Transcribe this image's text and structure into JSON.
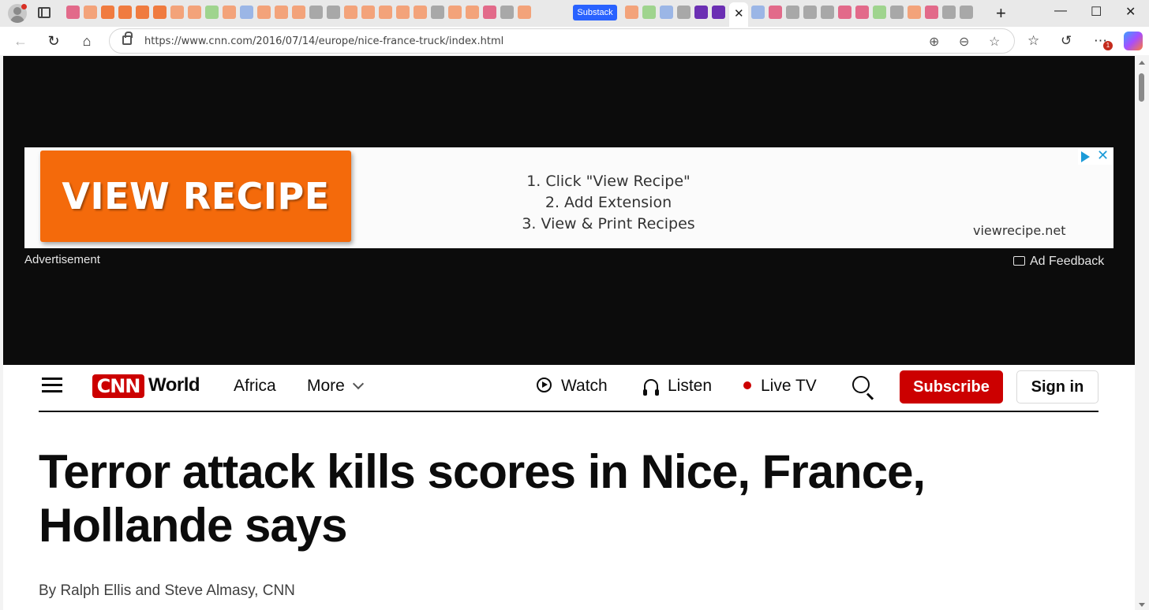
{
  "browser": {
    "tab_strip": {
      "labeled_tab": "Substack",
      "active_tab_close": "✕",
      "new_tab": "+"
    },
    "window_controls": {
      "minimize": "—",
      "maximize": "☐",
      "close": "✕"
    },
    "address_bar": {
      "url": "https://www.cnn.com/2016/07/14/europe/nice-france-truck/index.html"
    },
    "icons": [
      "back-icon",
      "refresh-icon",
      "home-icon",
      "lock-icon",
      "zoom-icon",
      "more-page-icon",
      "favorite-star-icon",
      "favorites-icon",
      "history-icon",
      "more-icon",
      "copilot-icon"
    ],
    "notification_count": "1"
  },
  "ad": {
    "cta": "VIEW RECIPE",
    "steps": [
      "1.  Click \"View Recipe\"",
      "2. Add Extension",
      "3. View & Print Recipes"
    ],
    "domain": "viewrecipe.net",
    "label": "Advertisement",
    "feedback": "Ad Feedback"
  },
  "cnn_header": {
    "logo": "CNN",
    "section": "World",
    "links": {
      "africa": "Africa",
      "more": "More",
      "watch": "Watch",
      "listen": "Listen",
      "live_tv": "Live TV"
    },
    "subscribe": "Subscribe",
    "sign_in": "Sign in",
    "brand_color": "#cc0000"
  },
  "article": {
    "headline": "Terror attack kills scores in Nice, France, Hollande says",
    "byline": "By Ralph Ellis and Steve Almasy, CNN"
  }
}
